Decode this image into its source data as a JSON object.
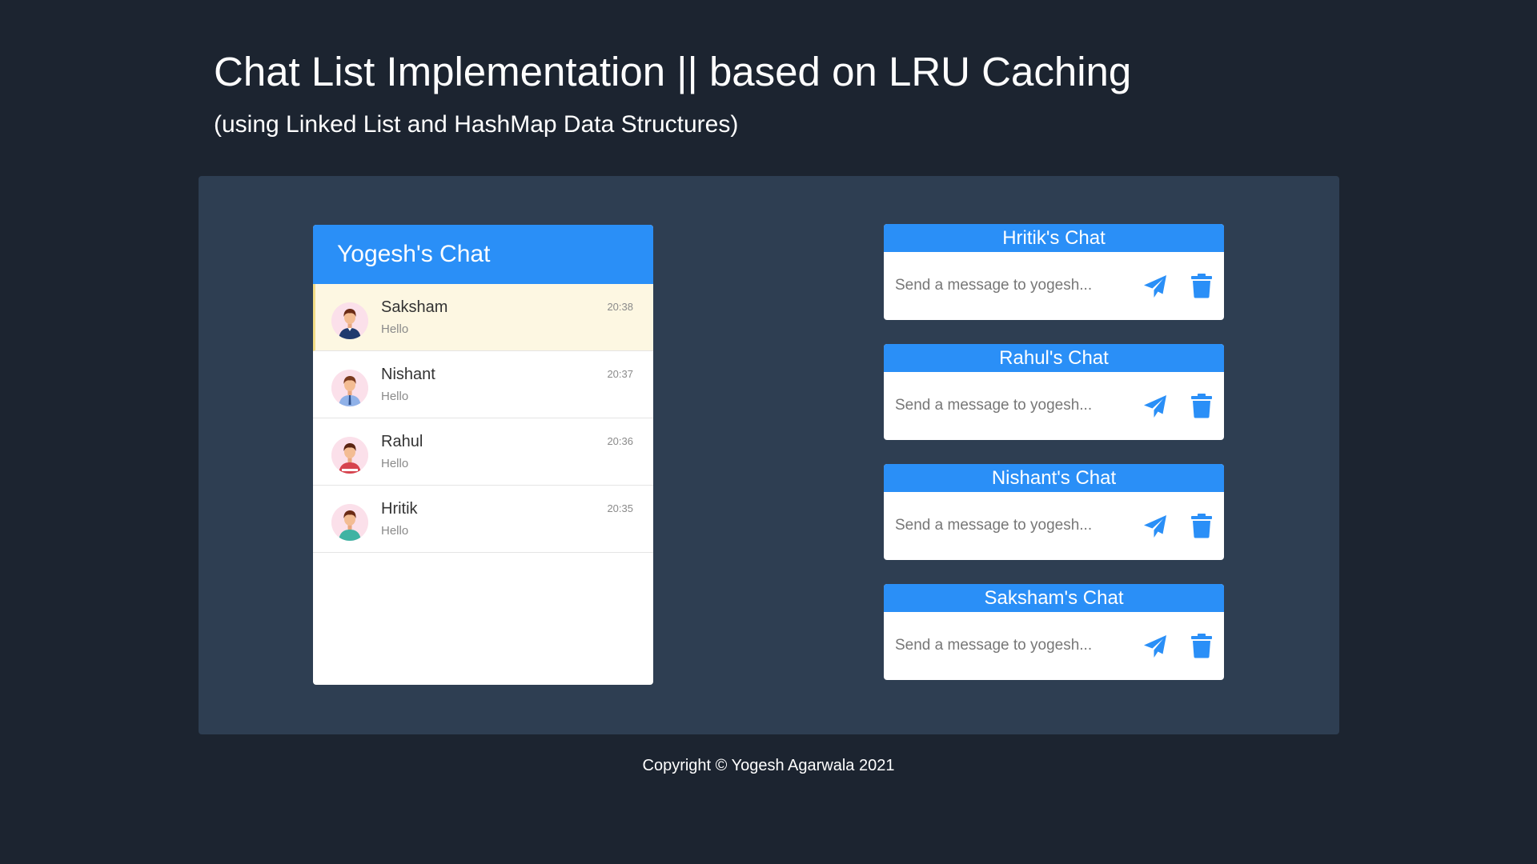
{
  "page": {
    "title": "Chat List Implementation || based on LRU Caching",
    "subtitle": "(using Linked List and HashMap Data Structures)"
  },
  "chat_list": {
    "title": "Yogesh's Chat",
    "items": [
      {
        "name": "Saksham",
        "message": "Hello",
        "time": "20:38",
        "active": true,
        "avatar": "boy-avatar-navy-shirt"
      },
      {
        "name": "Nishant",
        "message": "Hello",
        "time": "20:37",
        "active": false,
        "avatar": "boy-avatar-blue-shirt"
      },
      {
        "name": "Rahul",
        "message": "Hello",
        "time": "20:36",
        "active": false,
        "avatar": "boy-avatar-red-shirt"
      },
      {
        "name": "Hritik",
        "message": "Hello",
        "time": "20:35",
        "active": false,
        "avatar": "boy-avatar-teal-shirt"
      }
    ]
  },
  "chat_boxes": [
    {
      "title": "Hritik's Chat",
      "placeholder": "Send a message to yogesh...",
      "send_icon": "paper-plane-icon",
      "delete_icon": "trash-icon"
    },
    {
      "title": "Rahul's Chat",
      "placeholder": "Send a message to yogesh...",
      "send_icon": "paper-plane-icon",
      "delete_icon": "trash-icon"
    },
    {
      "title": "Nishant's Chat",
      "placeholder": "Send a message to yogesh...",
      "send_icon": "paper-plane-icon",
      "delete_icon": "trash-icon"
    },
    {
      "title": "Saksham's Chat",
      "placeholder": "Send a message to yogesh...",
      "send_icon": "paper-plane-icon",
      "delete_icon": "trash-icon"
    }
  ],
  "footer": {
    "copyright": "Copyright © Yogesh Agarwala 2021"
  },
  "colors": {
    "background": "#1c2430",
    "panel": "#2e3e52",
    "accent": "#2a8ff7",
    "active_row": "#fdf7e2"
  }
}
